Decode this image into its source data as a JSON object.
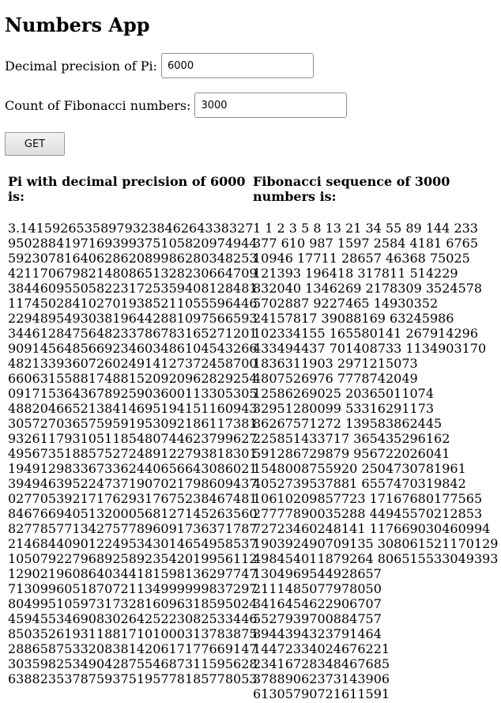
{
  "app": {
    "title": "Numbers App"
  },
  "form": {
    "pi_label": "Decimal precision of Pi:",
    "pi_value": "6000",
    "fib_label": "Count of Fibonacci numbers:",
    "fib_value": "3000",
    "get_label": "GET"
  },
  "results": {
    "pi_heading": "Pi with decimal precision of 6000 is:",
    "fib_heading": "Fibonacci sequence of 3000 numbers is:",
    "pi_lines": [
      "3.14159265358979323846264338327",
      "9502884197169399375105820974944",
      "5923078164062862089986280348253",
      "4211706798214808651328230664709",
      "3844609550582231725359408128481",
      "1174502841027019385211055596446",
      "2294895493038196442881097566593",
      "3446128475648233786783165271201",
      "9091456485669234603486104543266",
      "4821339360726024914127372458700",
      "6606315588174881520920962829254",
      "0917153643678925903600113305305",
      "4882046652138414695194151160943",
      "3057270365759591953092186117381",
      "9326117931051185480744623799627",
      "4956735188575272489122793818301",
      "1949129833673362440656643086021",
      "3949463952247371907021798609437",
      "0277053921717629317675238467481",
      "8467669405132000568127145263560",
      "8277857713427577896091736371787",
      "2146844090122495343014654958537",
      "1050792279689258923542019956112",
      "1290219608640344181598136297747",
      "7130996051870721134999999837297",
      "8049951059731732816096318595024",
      "4594553469083026425223082533446",
      "8503526193118817101000313783875",
      "2886587533208381420617177669147",
      "3035982534904287554687311595628",
      "6388235378759375195778185778053"
    ],
    "fib_lines": [
      "1 1 2 3 5 8 13 21 34 55 89 144 233",
      "377 610 987 1597 2584 4181 6765",
      "10946 17711 28657 46368 75025",
      "121393 196418 317811 514229",
      "832040 1346269 2178309 3524578",
      "5702887 9227465 14930352",
      "24157817 39088169 63245986",
      "102334155 165580141 267914296",
      "433494437 701408733 1134903170",
      "1836311903 2971215073",
      "4807526976 7778742049",
      "12586269025 20365011074",
      "32951280099 53316291173",
      "86267571272 139583862445",
      "225851433717 365435296162",
      "591286729879 956722026041",
      "1548008755920 2504730781961",
      "4052739537881 6557470319842",
      "10610209857723 17167680177565",
      "27777890035288 44945570212853",
      "72723460248141 117669030460994",
      "190392490709135 308061521170129",
      "498454011879264 806515533049393",
      "1304969544928657",
      "2111485077978050",
      "3416454622906707",
      "5527939700884757",
      "8944394323791464",
      "14472334024676221",
      "23416728348467685",
      "37889062373143906",
      "61305790721611591"
    ]
  }
}
